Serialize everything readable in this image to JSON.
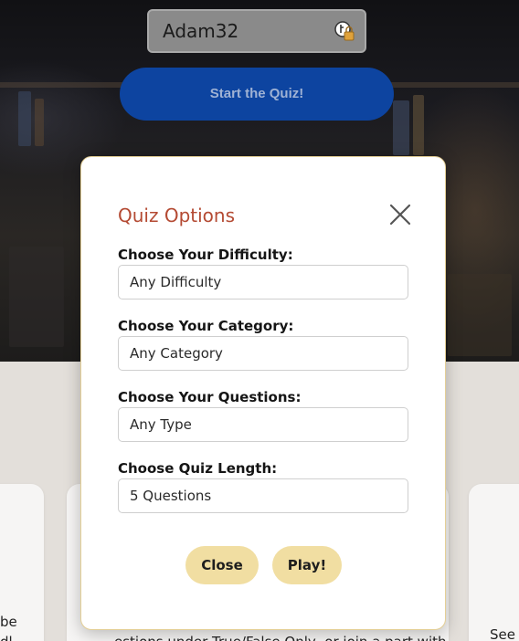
{
  "login": {
    "username_value": "Adam32",
    "password_manager_icon": "key-lock-icon"
  },
  "hero": {
    "start_button_label": "Start the Quiz!"
  },
  "background_cards": {
    "left_partial_text_1": "be",
    "left_partial_text_2": "dl",
    "middle_partial_text": "estions under True/False Only, or join a part with",
    "right_partial_text": "See y"
  },
  "modal": {
    "title": "Quiz Options",
    "close_icon": "close-x-icon",
    "fields": [
      {
        "label": "Choose Your Difficulty:",
        "value": "Any Difficulty"
      },
      {
        "label": "Choose Your Category:",
        "value": "Any Category"
      },
      {
        "label": "Choose Your Questions:",
        "value": "Any Type"
      },
      {
        "label": "Choose Quiz Length:",
        "value": "5 Questions"
      }
    ],
    "close_button_label": "Close",
    "play_button_label": "Play!"
  },
  "colors": {
    "title": "#b44a33",
    "start_button": "#0d44a0",
    "pill_button": "#f1dea2",
    "modal_border": "#e4cf96"
  }
}
